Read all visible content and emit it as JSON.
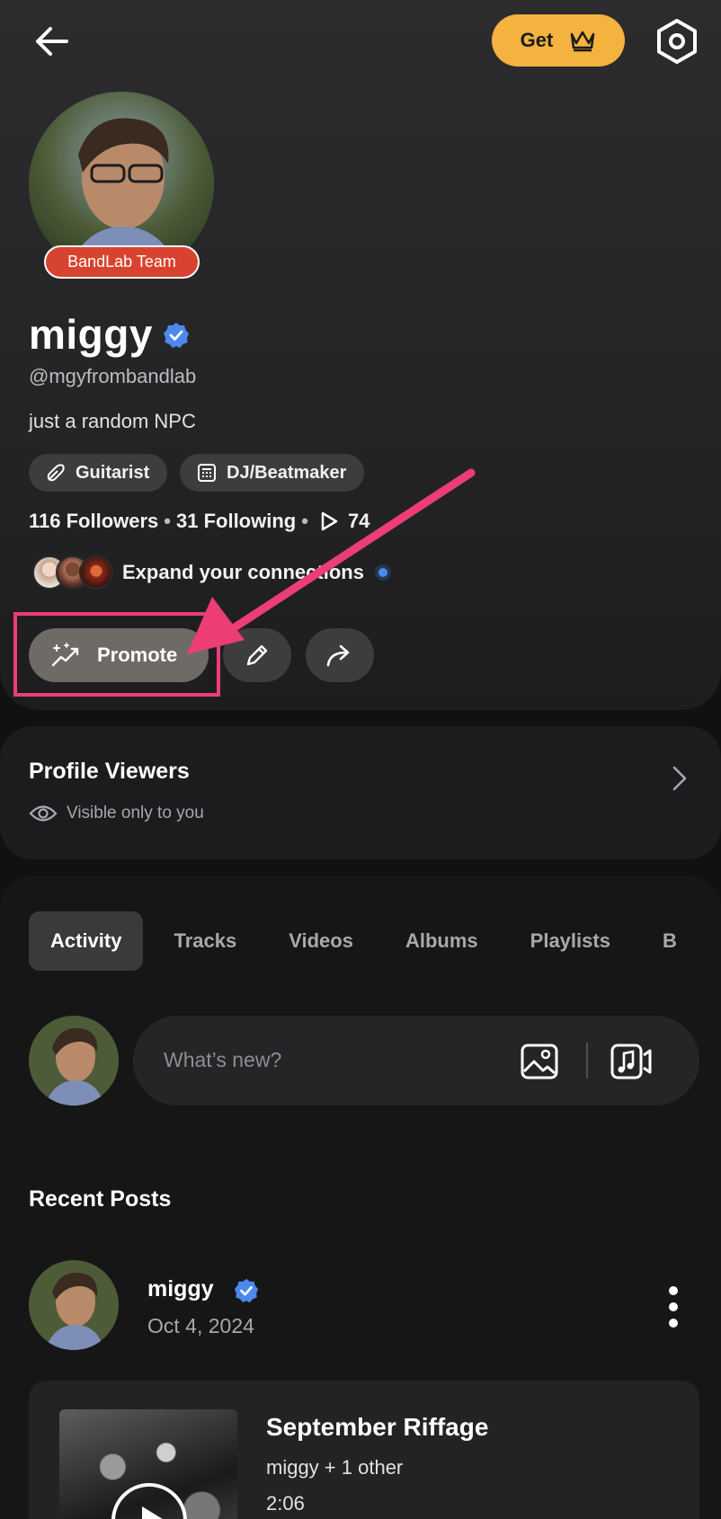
{
  "header": {
    "get_label": "Get",
    "team_badge": "BandLab Team"
  },
  "profile": {
    "name": "miggy",
    "handle": "@mgyfrombandlab",
    "bio": "just a random NPC",
    "tags": [
      "Guitarist",
      "DJ/Beatmaker"
    ],
    "followers": "116 Followers",
    "following": "31 Following",
    "plays": "74",
    "connect_text": "Expand your connections",
    "promote_label": "Promote"
  },
  "viewers": {
    "title": "Profile Viewers",
    "subtitle": "Visible only to you"
  },
  "tabs": [
    {
      "label": "Activity",
      "active": true
    },
    {
      "label": "Tracks"
    },
    {
      "label": "Videos"
    },
    {
      "label": "Albums"
    },
    {
      "label": "Playlists"
    },
    {
      "label": "B"
    }
  ],
  "composer": {
    "placeholder": "What’s new?"
  },
  "recent": {
    "heading": "Recent Posts",
    "post": {
      "author": "miggy",
      "date": "Oct 4, 2024",
      "track_title": "September Riffage",
      "track_artist": "miggy + 1 other",
      "track_length": "2:06"
    }
  },
  "colors": {
    "accent_get": "#f4b23e",
    "team_badge": "#d8432f",
    "verified": "#4c88ee",
    "highlight": "#ec3d74"
  }
}
